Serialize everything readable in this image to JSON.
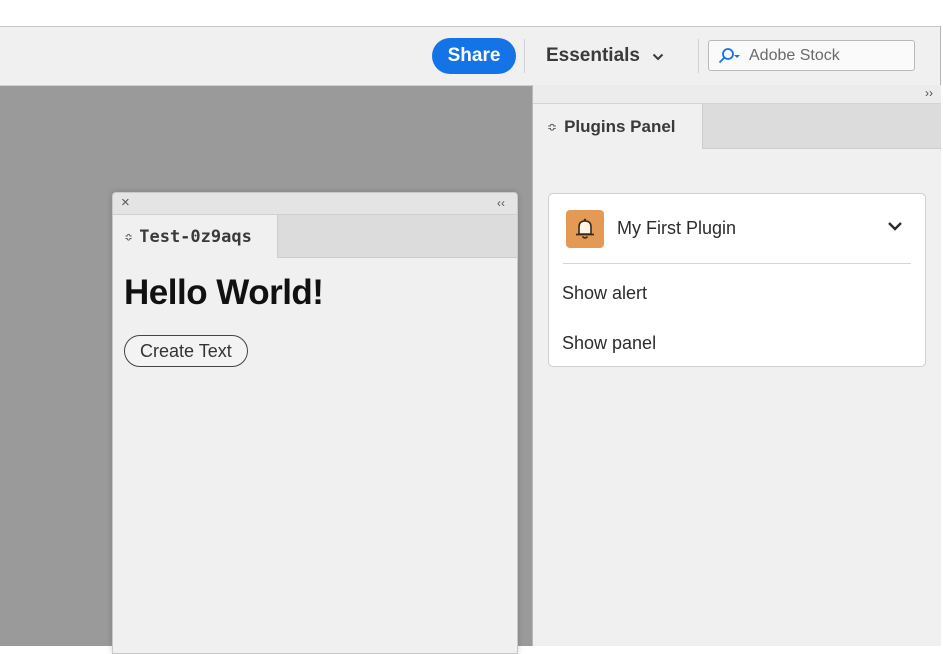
{
  "topbar": {
    "share_label": "Share",
    "workspace_label": "Essentials",
    "search_placeholder": "Adobe Stock"
  },
  "dock": {
    "collapse_glyph": "››",
    "tab_label": "Plugins Panel",
    "plugin": {
      "name": "My First Plugin",
      "icon": "bell-icon",
      "menu_items": [
        "Show alert",
        "Show panel"
      ]
    }
  },
  "float_panel": {
    "close_glyph": "×",
    "collapse_glyph": "‹‹",
    "tab_label": "Test-0z9aqs",
    "heading": "Hello World!",
    "button_label": "Create Text"
  },
  "colors": {
    "share_blue": "#1473e6",
    "canvas_gray": "#9a9a9a",
    "panel_bg": "#f0f0f0",
    "plugin_icon_orange": "#e49a55"
  }
}
